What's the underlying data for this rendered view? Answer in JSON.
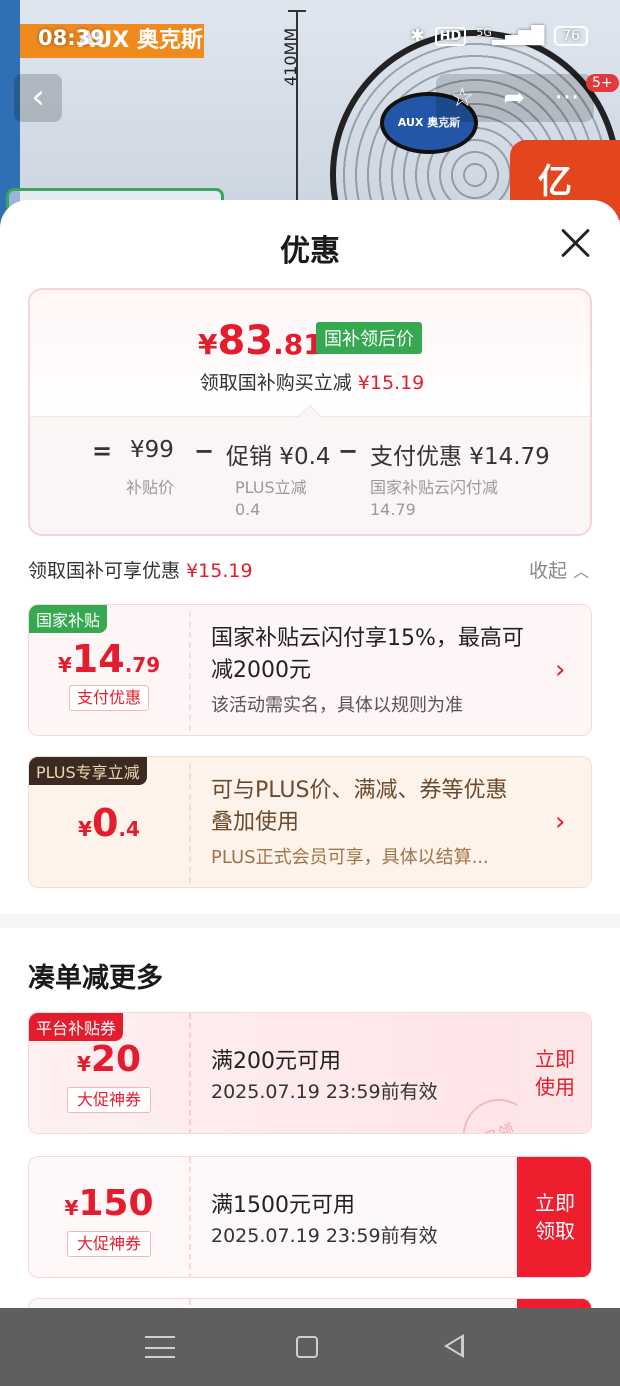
{
  "status_bar": {
    "time": "08:39",
    "network": "5G",
    "hd": "HD",
    "battery": "76"
  },
  "product_bg": {
    "brand": "AUX 奥克斯",
    "dimension": "410MM",
    "hub_label": "AUX 奥克斯",
    "corner_badge": "亿"
  },
  "top_nav": {
    "cart_count": "5+"
  },
  "sheet": {
    "title": "优惠",
    "price_summary": {
      "currency": "¥",
      "price_int": "83",
      "price_dec": ".81",
      "tag": "国补领后价",
      "subtitle_prefix": "领取国补购买立减",
      "subtitle_amount": "¥15.19",
      "formula": {
        "eq": "=",
        "base_value": "¥99",
        "base_label": "补贴价",
        "minus1": "−",
        "promo_value": "促销 ¥0.4",
        "promo_label1": "PLUS立减",
        "promo_label2": "0.4",
        "minus2": "−",
        "pay_value": "支付优惠 ¥14.79",
        "pay_label1": "国家补贴云闪付减",
        "pay_label2": "14.79"
      }
    },
    "benefits_header": {
      "label": "领取国补可享优惠",
      "amount": "¥15.19",
      "toggle": "收起"
    },
    "benefits": [
      {
        "ribbon": "国家补贴",
        "currency": "¥",
        "amount_int": "14",
        "amount_dec": ".79",
        "pill": "支付优惠",
        "desc": "国家补贴云闪付享15%，最高可减2000元",
        "note": "该活动需实名，具体以规则为准"
      },
      {
        "ribbon": "PLUS专享立减",
        "currency": "¥",
        "amount_int": "0",
        "amount_dec": ".4",
        "desc": "可与PLUS价、满减、券等优惠叠加使用",
        "note": "PLUS正式会员可享，具体以结算..."
      }
    ],
    "more_section": {
      "title": "凑单减更多",
      "coupons": [
        {
          "ribbon": "平台补贴券",
          "currency": "¥",
          "amount": "20",
          "pill": "大促神券",
          "condition": "满200元可用",
          "expiry": "2025.07.19 23:59前有效",
          "action_line1": "立即",
          "action_line2": "使用",
          "stamp": "已领"
        },
        {
          "currency": "¥",
          "amount": "150",
          "pill": "大促神券",
          "condition": "满1500元可用",
          "expiry": "2025.07.19 23:59前有效",
          "action_line1": "立即",
          "action_line2": "领取"
        }
      ]
    }
  },
  "colors": {
    "accent_red": "#e31d2d",
    "subsidy_green": "#36a852",
    "plus_brown": "#3b2a22",
    "plus_gold": "#a0744a"
  }
}
